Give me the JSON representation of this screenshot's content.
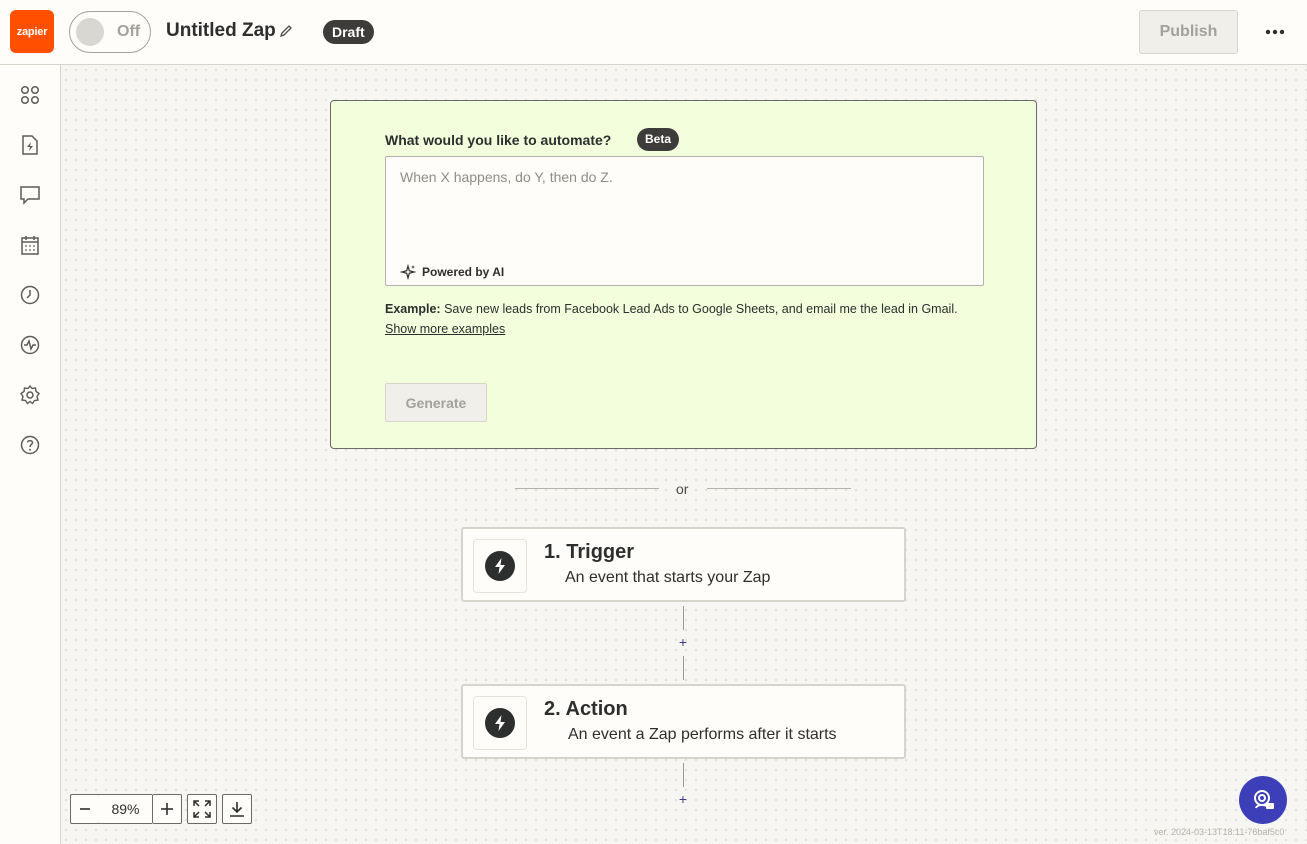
{
  "header": {
    "logo_text": "zapier",
    "toggle_label": "Off",
    "zap_title": "Untitled Zap",
    "status_badge": "Draft",
    "publish_label": "Publish",
    "more_icon": "more-horizontal-icon"
  },
  "sidebar": {
    "items": [
      {
        "icon": "apps-icon"
      },
      {
        "icon": "zap-file-icon"
      },
      {
        "icon": "comment-icon"
      },
      {
        "icon": "calendar-icon"
      },
      {
        "icon": "history-icon"
      },
      {
        "icon": "activity-icon"
      },
      {
        "icon": "settings-icon"
      },
      {
        "icon": "help-icon"
      }
    ]
  },
  "ai_builder": {
    "label": "What would you like to automate?",
    "badge": "Beta",
    "placeholder": "When X happens, do Y, then do Z.",
    "powered_by": "Powered by AI",
    "example_prefix": "Example:",
    "example_text": "Save new leads from Facebook Lead Ads to Google Sheets, and email me the lead in Gmail.",
    "show_more": "Show more examples",
    "generate_label": "Generate"
  },
  "divider": {
    "text": "or"
  },
  "steps": [
    {
      "title": "1. Trigger",
      "description": "An event that starts your Zap"
    },
    {
      "title": "2. Action",
      "description": "An event a Zap performs after it starts"
    }
  ],
  "add_step_label": "+",
  "zoom": {
    "minus": "−",
    "value": "89%",
    "plus": "+"
  },
  "version": "ver. 2024-03-13T18:11-76baf5c0",
  "colors": {
    "brand": "#ff4f00",
    "ai_box_bg": "#f3fedd",
    "fab": "#3d3fb8"
  }
}
